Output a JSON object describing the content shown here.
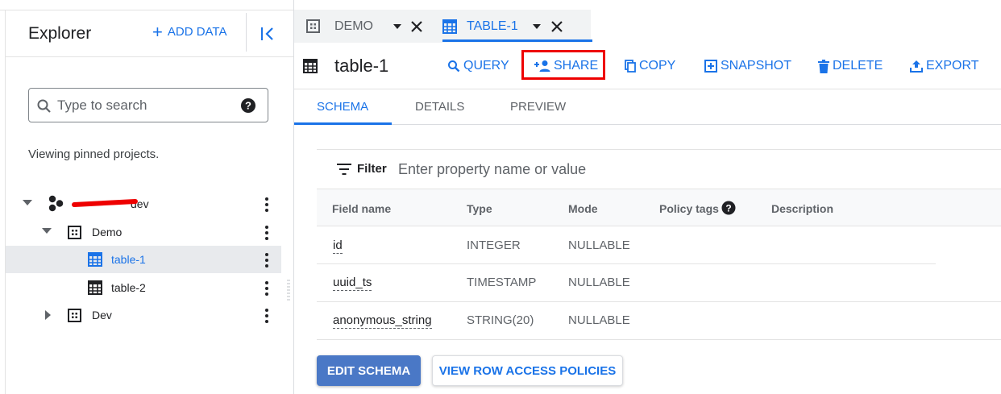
{
  "explorer": {
    "title": "Explorer",
    "add_data_label": "ADD DATA",
    "search_placeholder": "Type to search",
    "pinned_text": "Viewing pinned projects.",
    "tree": [
      {
        "label": "dev",
        "icon": "project-hexagon-icon",
        "expanded": true,
        "level": 0
      },
      {
        "label": "Demo",
        "icon": "dataset-icon",
        "expanded": true,
        "level": 1
      },
      {
        "label": "table-1",
        "icon": "table-icon",
        "selected": true,
        "level": 2
      },
      {
        "label": "table-2",
        "icon": "table-icon",
        "level": 2
      },
      {
        "label": "Dev",
        "icon": "dataset-icon",
        "expanded": false,
        "level": 1
      }
    ]
  },
  "tabs": [
    {
      "label": "DEMO",
      "icon": "dataset-icon",
      "active": false
    },
    {
      "label": "TABLE-1",
      "icon": "table-icon",
      "active": true
    }
  ],
  "toolbar": {
    "title": "table-1",
    "query": "QUERY",
    "share": "SHARE",
    "copy": "COPY",
    "snapshot": "SNAPSHOT",
    "delete": "DELETE",
    "export": "EXPORT"
  },
  "subtabs": {
    "schema": "SCHEMA",
    "details": "DETAILS",
    "preview": "PREVIEW"
  },
  "schema": {
    "filter_label": "Filter",
    "filter_placeholder": "Enter property name or value",
    "headers": {
      "field_name": "Field name",
      "type": "Type",
      "mode": "Mode",
      "policy_tags": "Policy tags",
      "description": "Description"
    },
    "rows": [
      {
        "field": "id",
        "type": "INTEGER",
        "mode": "NULLABLE"
      },
      {
        "field": "uuid_ts",
        "type": "TIMESTAMP",
        "mode": "NULLABLE"
      },
      {
        "field": "anonymous_string",
        "type": "STRING(20)",
        "mode": "NULLABLE"
      }
    ]
  },
  "actions": {
    "edit_schema": "EDIT SCHEMA",
    "view_row_access_policies": "VIEW ROW ACCESS POLICIES"
  },
  "colors": {
    "accent": "#1a73e8",
    "highlight": "#e00000",
    "primary_button": "#4a78c6"
  }
}
